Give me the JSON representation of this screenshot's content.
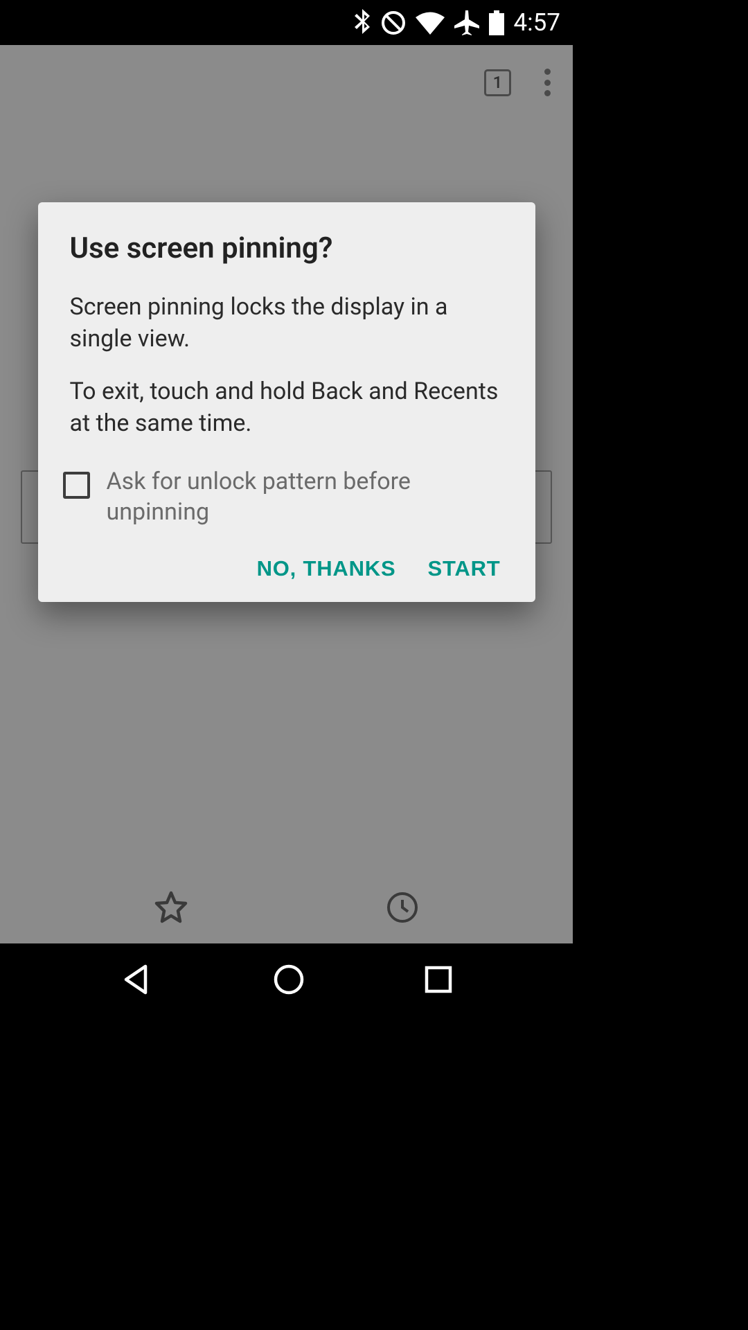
{
  "status": {
    "time": "4:57"
  },
  "toolbar": {
    "tab_count": "1"
  },
  "dialog": {
    "title": "Use screen pinning?",
    "body1": "Screen pinning locks the display in a single view.",
    "body2": "To exit, touch and hold Back and Recents at the same time.",
    "checkbox_label": "Ask for unlock pattern before unpinning",
    "no_label": "NO, THANKS",
    "start_label": "START"
  },
  "colors": {
    "accent": "#009688"
  }
}
